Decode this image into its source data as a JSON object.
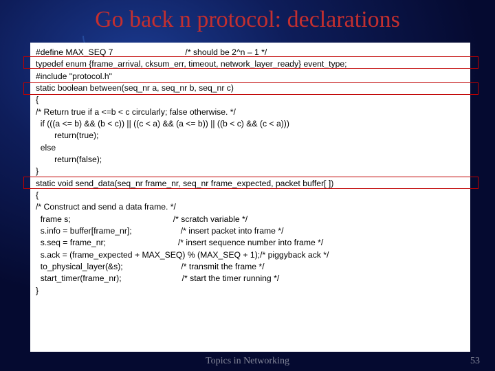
{
  "slide": {
    "title": "Go back n protocol: declarations",
    "footer": "Topics in Networking",
    "page": "53"
  },
  "code": {
    "lines": [
      "#define MAX_SEQ 7                               /* should be 2^n – 1 */",
      "typedef enum {frame_arrival, cksum_err, timeout, network_layer_ready} event_type;",
      "#include \"protocol.h\"",
      "",
      "static boolean between(seq_nr a, seq_nr b, seq_nr c)",
      "{",
      "/* Return true if a <=b < c circularly; false otherwise. */",
      "  if (((a <= b) && (b < c)) || ((c < a) && (a <= b)) || ((b < c) && (c < a)))",
      "        return(true);",
      "  else",
      "        return(false);",
      "}",
      "",
      "static void send_data(seq_nr frame_nr, seq_nr frame_expected, packet buffer[ ])",
      "{",
      "/* Construct and send a data frame. */",
      "  frame s;                                            /* scratch variable */",
      "",
      "  s.info = buffer[frame_nr];                     /* insert packet into frame */",
      "  s.seq = frame_nr;                               /* insert sequence number into frame */",
      "  s.ack = (frame_expected + MAX_SEQ) % (MAX_SEQ + 1);/* piggyback ack */",
      "  to_physical_layer(&s);                         /* transmit the frame */",
      "  start_timer(frame_nr);                          /* start the timer running */",
      "}"
    ]
  }
}
